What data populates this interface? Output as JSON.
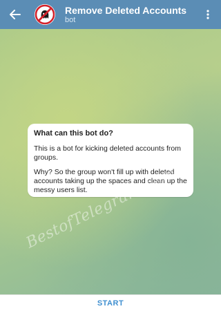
{
  "header": {
    "title": "Remove Deleted Accounts",
    "subtitle": "bot",
    "back_icon": "arrow-left-icon",
    "more_icon": "vertical-dots-icon",
    "avatar_icon": "crossed-out-ghost-avatar",
    "bg_color": "#5b8db5"
  },
  "bubble": {
    "title": "What can this bot do?",
    "paragraph1": "This is a bot for kicking deleted accounts from groups.",
    "paragraph2": "Why? So the group won't fill up with deleted accounts taking up the spaces and clean up the messy users list."
  },
  "watermark": {
    "text": "BestofTelegram.com"
  },
  "footer": {
    "start_label": "START",
    "accent_color": "#3f8fd0"
  }
}
